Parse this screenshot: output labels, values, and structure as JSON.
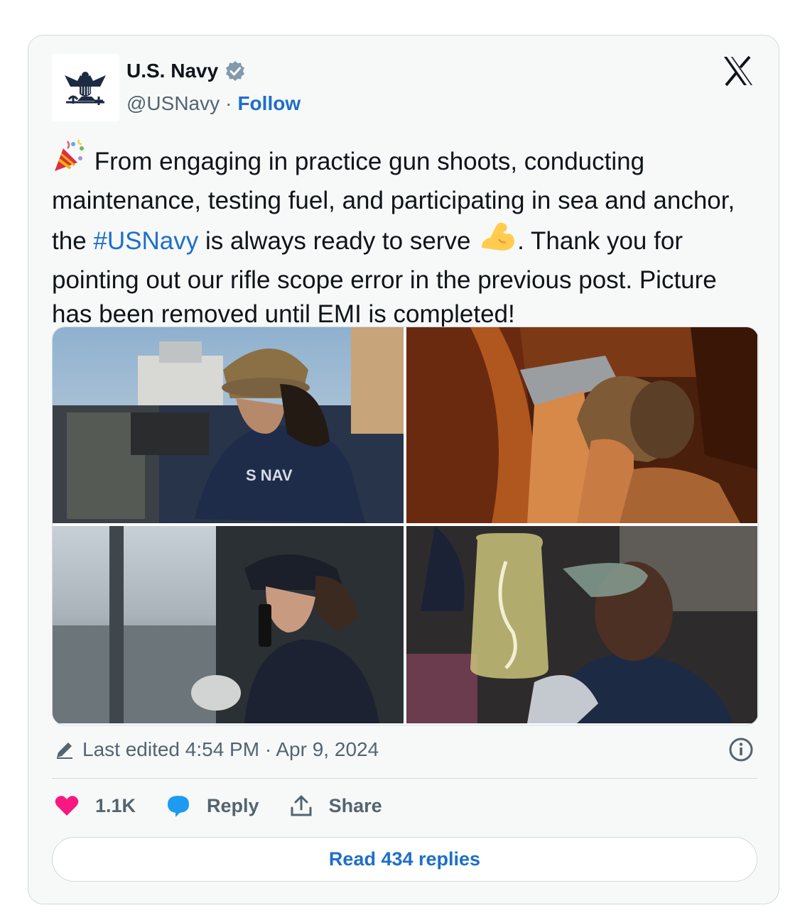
{
  "author": {
    "name": "U.S. Navy",
    "handle": "@USNavy",
    "separator": "·",
    "follow_label": "Follow"
  },
  "tweet": {
    "text_part1": " From engaging in practice gun shoots, conducting maintenance, testing fuel, and participating in sea and anchor, the ",
    "hashtag": "#USNavy",
    "text_part2": " is always ready to serve ",
    "text_part3": ". Thank you for pointing out our rifle scope error in the previous post. Picture has been removed until EMI is completed!",
    "emoji_start": "party-popper",
    "emoji_mid": "flexed-biceps"
  },
  "edited": {
    "label": "Last edited 4:54 PM · Apr 9, 2024"
  },
  "actions": {
    "likes": "1.1K",
    "reply_label": "Reply",
    "share_label": "Share"
  },
  "read_replies_label": "Read 434 replies",
  "colors": {
    "link_blue": "#1d6fc8",
    "like_pink": "#f91880",
    "reply_blue": "#1d9bf0",
    "muted": "#536471"
  }
}
